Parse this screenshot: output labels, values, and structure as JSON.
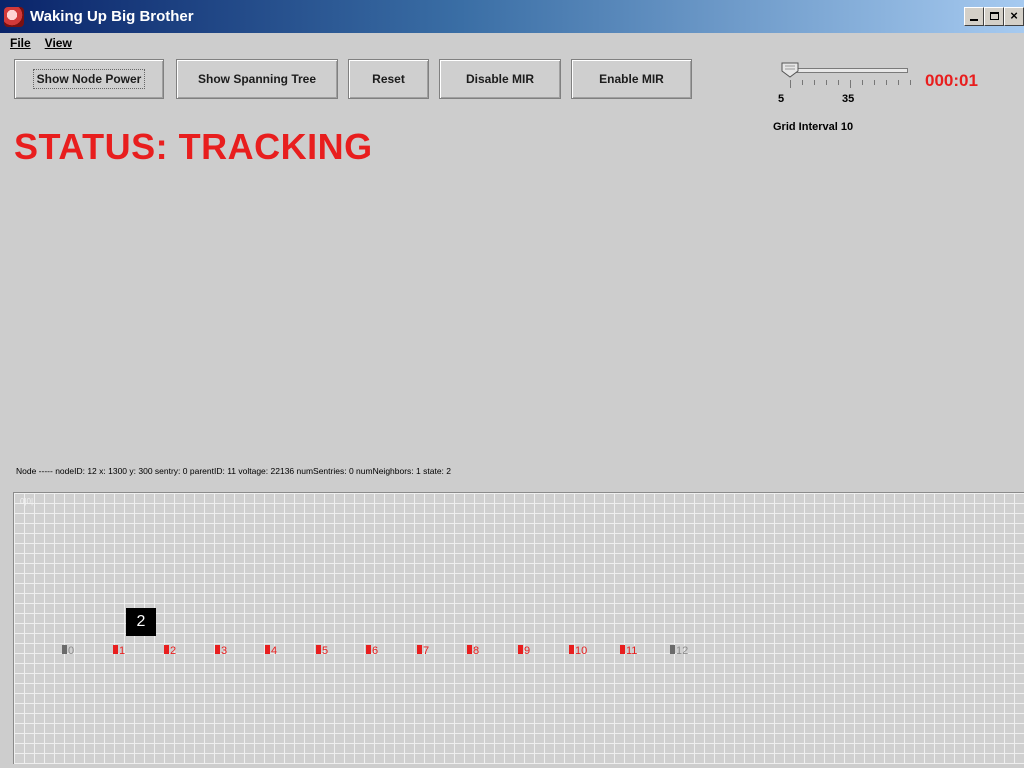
{
  "window": {
    "title": "Waking Up Big Brother",
    "controls": [
      "_",
      "□",
      "×"
    ]
  },
  "menu": [
    {
      "label": "File",
      "accel": "F"
    },
    {
      "label": "View",
      "accel": "V"
    }
  ],
  "toolbar": {
    "buttons": [
      {
        "label": "Show Node Power",
        "focused": true
      },
      {
        "label": "Show Spanning Tree",
        "focused": false
      },
      {
        "label": "Reset",
        "focused": false
      },
      {
        "label": "Disable MIR",
        "focused": false
      },
      {
        "label": "Enable MIR",
        "focused": false
      }
    ]
  },
  "slider": {
    "min_label": "5",
    "mid_label": "35",
    "value": 5
  },
  "grid_interval_label": "Grid Interval 10",
  "timer": "000:01",
  "status": "STATUS: TRACKING",
  "node_info": "Node ----- nodeID: 12 x: 1300 y: 300 sentry: 0 parentID: 11 voltage: 22136 numSentries: 0 numNeighbors: 1 state: 2",
  "grid": {
    "origin_label": "0|0|",
    "tracker_label": "2",
    "nodes": [
      {
        "id": "0",
        "state": "inactive"
      },
      {
        "id": "1",
        "state": "active"
      },
      {
        "id": "2",
        "state": "active"
      },
      {
        "id": "3",
        "state": "active"
      },
      {
        "id": "4",
        "state": "active"
      },
      {
        "id": "5",
        "state": "active"
      },
      {
        "id": "6",
        "state": "active"
      },
      {
        "id": "7",
        "state": "active"
      },
      {
        "id": "8",
        "state": "active"
      },
      {
        "id": "9",
        "state": "active"
      },
      {
        "id": "10",
        "state": "active"
      },
      {
        "id": "11",
        "state": "active"
      },
      {
        "id": "12",
        "state": "inactive"
      }
    ]
  },
  "colors": {
    "accent_red": "#e81e1e",
    "inactive_gray": "#6a6a6a",
    "background": "#cdcdcd"
  }
}
